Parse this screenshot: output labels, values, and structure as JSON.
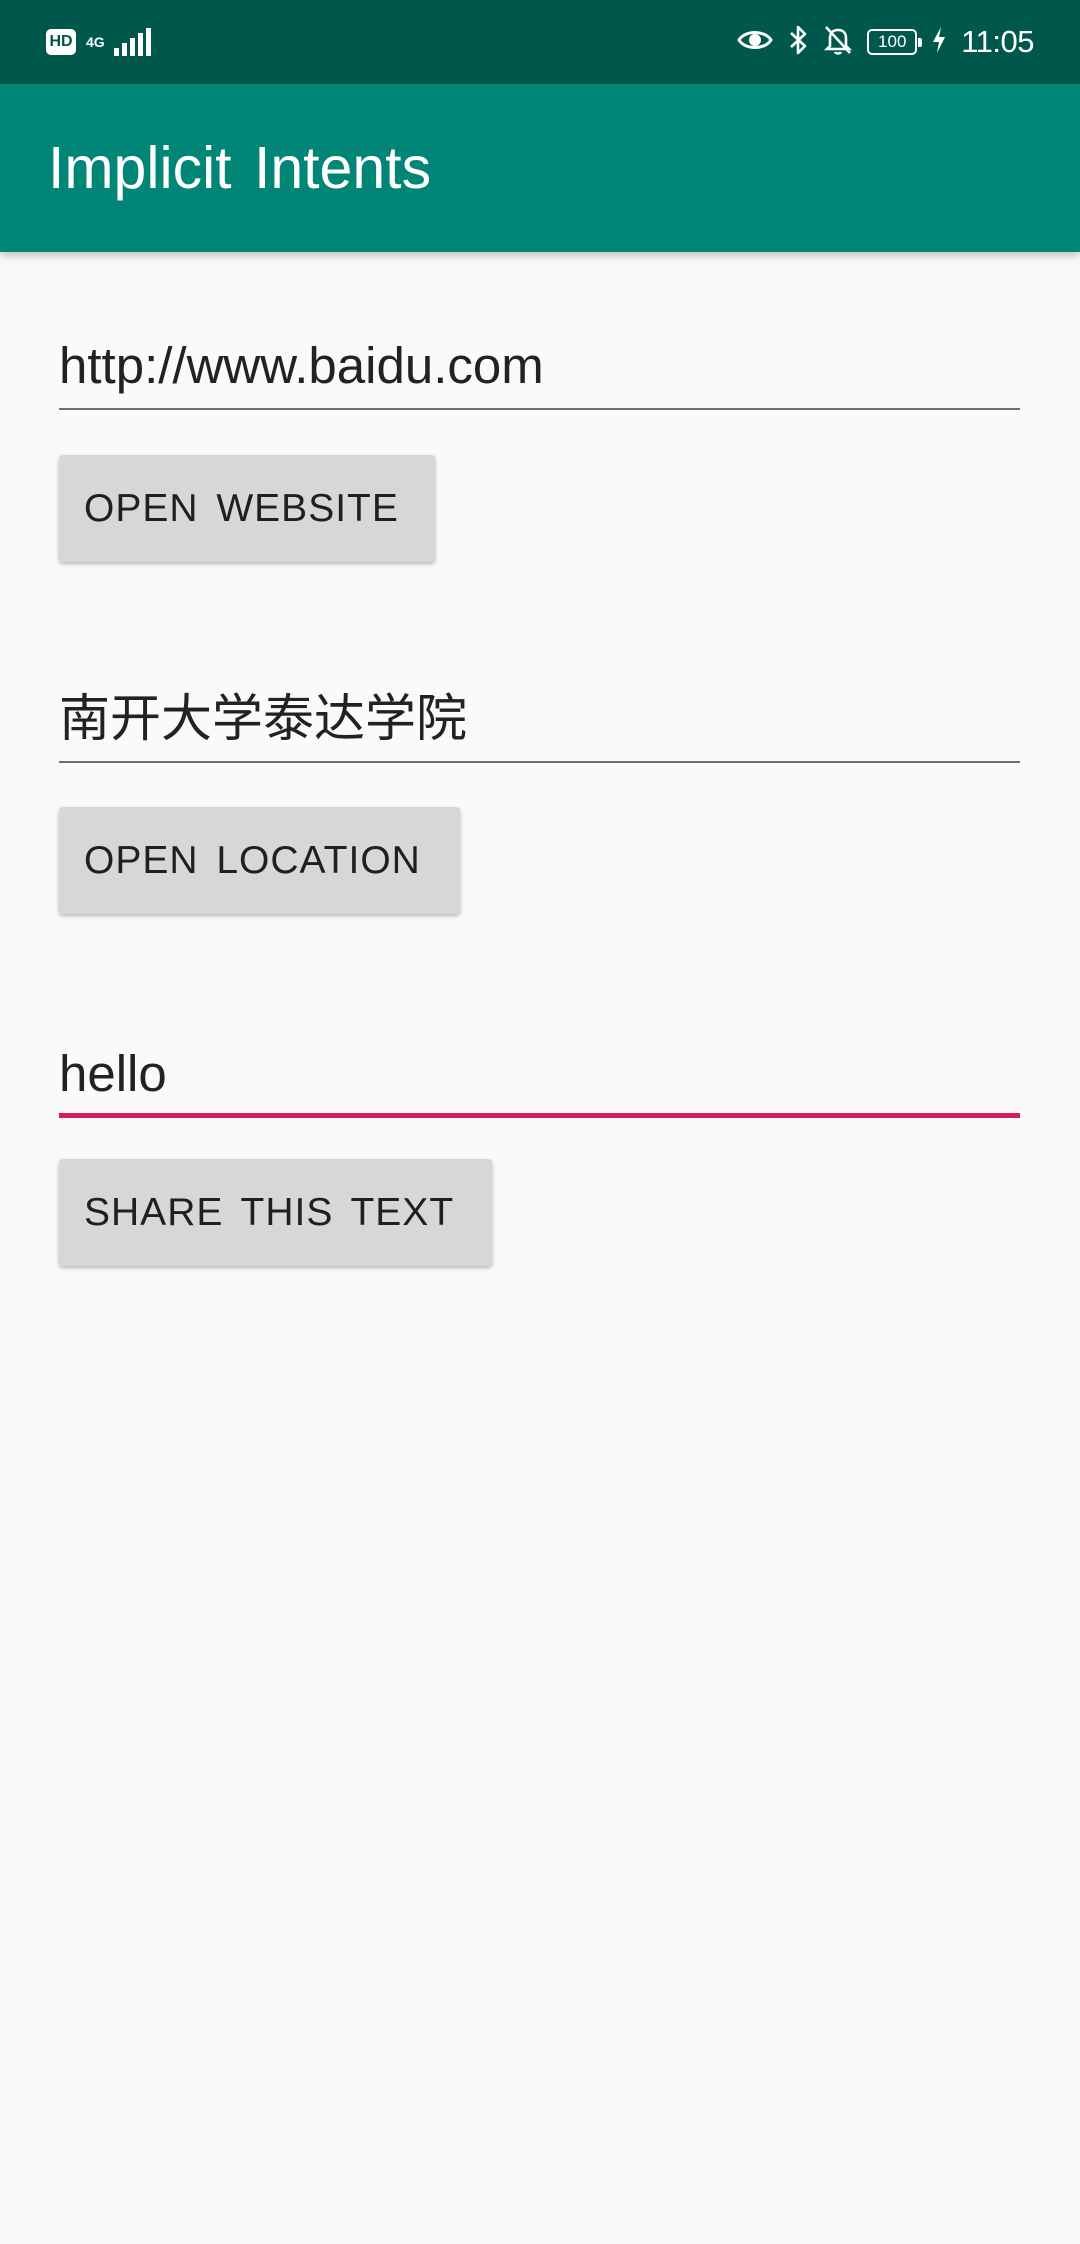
{
  "status_bar": {
    "hd_label": "HD",
    "network_type": "4G",
    "time": "11:05",
    "battery_level": "100",
    "icons": [
      "eye-comfort-icon",
      "bluetooth-icon",
      "notifications-off-icon",
      "charging-icon"
    ],
    "background_color": "#00574B"
  },
  "app_bar": {
    "title": "Implicit Intents",
    "background_color": "#008577"
  },
  "website_section": {
    "url_value": "http://www.baidu.com",
    "button_label": "OPEN WEBSITE"
  },
  "location_section": {
    "location_value": "南开大学泰达学院",
    "button_label": "OPEN LOCATION"
  },
  "share_section": {
    "text_value": "hello",
    "button_label": "SHARE THIS TEXT",
    "focused_underline_color": "#D81B60"
  }
}
